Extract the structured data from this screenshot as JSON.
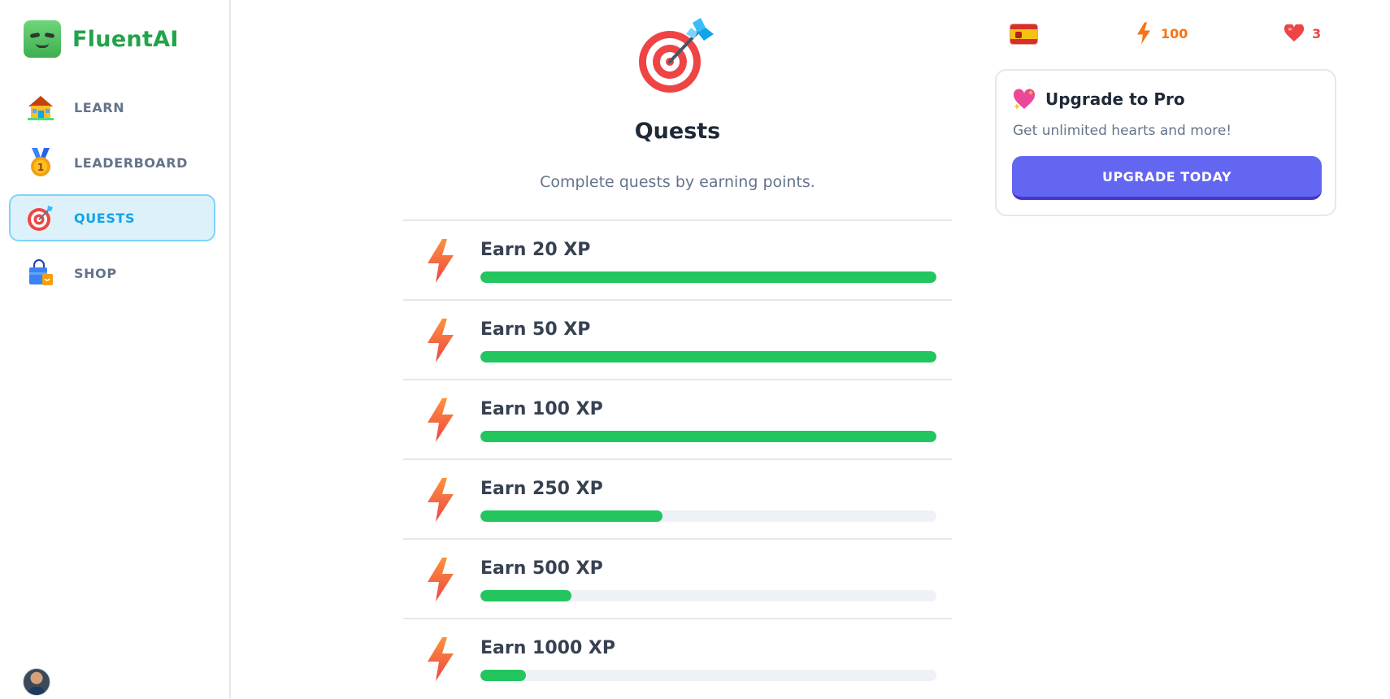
{
  "brand": {
    "name": "FluentAI"
  },
  "sidebar": {
    "items": [
      {
        "label": "LEARN",
        "icon": "house-icon",
        "active": false
      },
      {
        "label": "LEADERBOARD",
        "icon": "medal-icon",
        "active": false
      },
      {
        "label": "QUESTS",
        "icon": "target-icon",
        "active": true
      },
      {
        "label": "SHOP",
        "icon": "shopping-bag-icon",
        "active": false
      }
    ]
  },
  "main": {
    "title": "Quests",
    "subtitle": "Complete quests by earning points.",
    "quests": [
      {
        "title": "Earn 20 XP",
        "progress": 1.0
      },
      {
        "title": "Earn 50 XP",
        "progress": 1.0
      },
      {
        "title": "Earn 100 XP",
        "progress": 1.0
      },
      {
        "title": "Earn 250 XP",
        "progress": 0.4
      },
      {
        "title": "Earn 500 XP",
        "progress": 0.2
      },
      {
        "title": "Earn 1000 XP",
        "progress": 0.1
      }
    ]
  },
  "stats": {
    "language_flag": "spain-flag-icon",
    "xp": "100",
    "hearts": "3"
  },
  "pro": {
    "title": "Upgrade to Pro",
    "subtitle": "Get unlimited hearts and more!",
    "button": "UPGRADE TODAY"
  },
  "colors": {
    "brand": "#22a34a",
    "accent": "#0ea5e9",
    "progress": "#22c55e",
    "button": "#6366f1",
    "xp": "#f97316",
    "hearts": "#ef4444"
  }
}
